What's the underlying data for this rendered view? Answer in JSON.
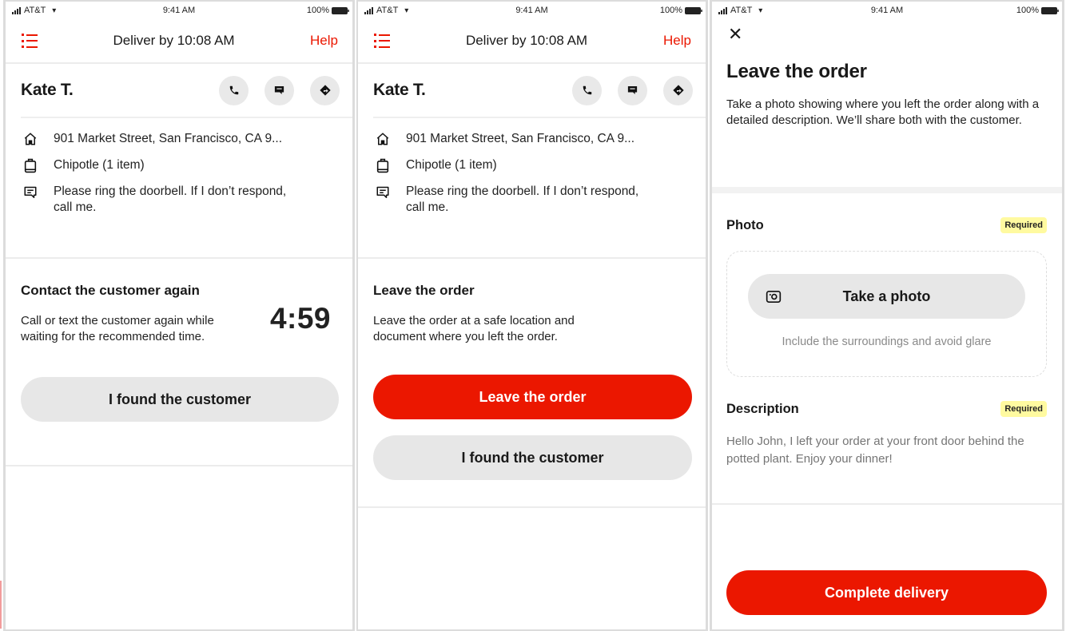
{
  "status_bar": {
    "carrier": "AT&T",
    "time": "9:41 AM",
    "battery": "100%"
  },
  "colors": {
    "brand_red": "#eb1700",
    "button_grey": "#e7e7e7",
    "required_badge": "#fffaa0"
  },
  "delivery_header": {
    "title": "Deliver by 10:08 AM",
    "help_label": "Help",
    "menu_icon": "menu-list-icon"
  },
  "customer": {
    "name": "Kate T.",
    "actions": [
      {
        "name": "call",
        "icon": "phone-icon"
      },
      {
        "name": "message",
        "icon": "chat-icon"
      },
      {
        "name": "directions",
        "icon": "directions-icon"
      }
    ],
    "address": "901 Market Street, San Francisco, CA 9...",
    "order": "Chipotle (1 item)",
    "note": "Please ring the doorbell. If I don’t respond, call me."
  },
  "screen1": {
    "section_title": "Contact the customer again",
    "section_desc": "Call or text the customer again while waiting for the recommended time.",
    "timer": "4:59",
    "found_button": "I found the customer"
  },
  "screen2": {
    "section_title": "Leave the order",
    "section_desc": "Leave the order at a safe location and document where you left the order.",
    "leave_button": "Leave the order",
    "found_button": "I found the customer"
  },
  "screen3": {
    "title": "Leave the order",
    "description": "Take a photo showing where you left the order along with a detailed description.  We’ll share both with the customer.",
    "photo": {
      "label": "Photo",
      "badge": "Required",
      "button": "Take a photo",
      "hint": "Include the surroundings and avoid glare"
    },
    "desc_field": {
      "label": "Description",
      "badge": "Required",
      "placeholder": "Hello John, I left your order at your front door behind the potted plant. Enjoy your dinner!"
    },
    "complete_button": "Complete delivery"
  }
}
